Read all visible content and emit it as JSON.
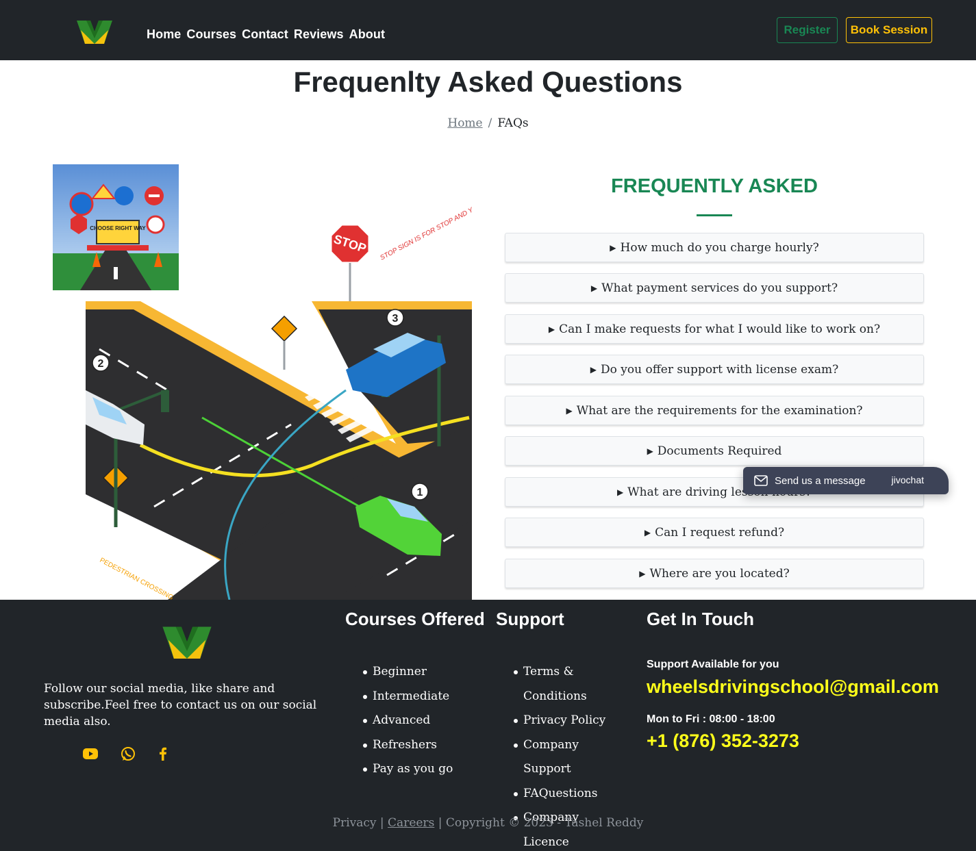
{
  "nav": {
    "links": [
      "Home",
      "Courses",
      "Contact",
      "Reviews",
      "About"
    ],
    "register_label": "Register",
    "book_label": "Book Session"
  },
  "header": {
    "title": "Frequenlty Asked Questions",
    "breadcrumb_home": "Home",
    "breadcrumb_sep": "/",
    "breadcrumb_current": "FAQs"
  },
  "images": {
    "sign_board_text": "CHOOSE RIGHT WAY",
    "stop_sign_text": "STOP",
    "stop_caption": "STOP SIGN IS FOR STOP AND YIELD.",
    "crossing_caption": "PEDESTRIAN CROSSING",
    "markers": [
      "1",
      "2",
      "3"
    ]
  },
  "faq": {
    "heading": "FREQUENTLY ASKED",
    "items": [
      "How much do you charge hourly?",
      "What payment services do you support?",
      "Can I make requests for what I would like to work on?",
      "Do you offer support with license exam?",
      "What are the requirements for the examination?",
      "Documents Required",
      "What are driving lesson hours?",
      "Can I request refund?",
      "Where are you located?"
    ]
  },
  "chat": {
    "label": "Send us a message",
    "brand": "jivochat"
  },
  "footer": {
    "about": "Follow our social media, like share and subscribe.Feel free to contact us on our social media also.",
    "courses_heading": "Courses Offered",
    "courses": [
      "Beginner",
      "Intermediate",
      "Advanced",
      "Refreshers",
      "Pay as you go"
    ],
    "support_heading": "Support",
    "support_links": [
      "Terms & Conditions",
      "Privacy Policy",
      "Company Support",
      "FAQuestions",
      "Company Licence"
    ],
    "contact_heading": "Get In Touch",
    "support_available": "Support Available for you",
    "email": "wheelsdrivingschool@gmail.com",
    "hours": "Mon to Fri : 08:00 - 18:00",
    "phone": "+1 (876) 352-3273",
    "copyright_privacy": "Privacy",
    "copyright_careers": "Careers",
    "copyright_text": "| Copyright © 2023 - Tashel Reddy"
  },
  "colors": {
    "navbar_bg": "#212529",
    "accent_green": "#198754",
    "accent_yellow": "#ffc107",
    "contact_yellow": "#ffff1a"
  },
  "icons": [
    "logo-icon",
    "youtube-icon",
    "whatsapp-icon",
    "facebook-icon",
    "envelope-icon"
  ]
}
